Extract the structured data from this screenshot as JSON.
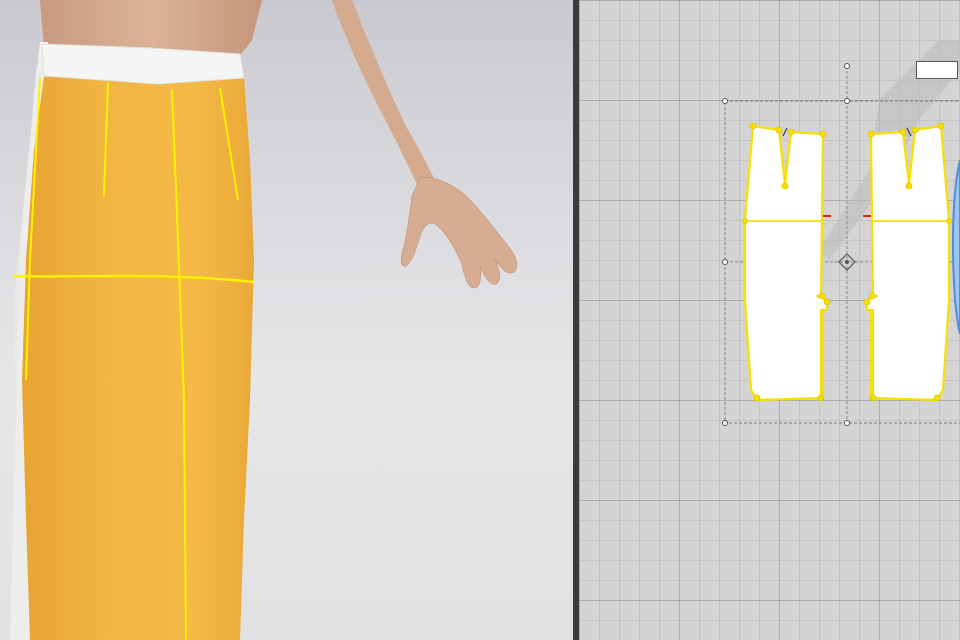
{
  "app": {
    "viewports": [
      "3d-avatar-view",
      "2d-pattern-view"
    ]
  },
  "colors": {
    "garment": "#f2b640",
    "seam_line": "#fff200",
    "waistband": "#f4f4f2",
    "pattern_fill": "#ffffff",
    "pattern_outline": "#f7e000",
    "grid_bg": "#d4d4d4",
    "bounding_box": "#777777",
    "notch_red": "#e02020",
    "adjacent_piece": "#5ea0e0"
  },
  "view_3d": {
    "garment": "skirt",
    "avatar_visible": true
  },
  "view_2d": {
    "pattern_pieces": [
      "back-left-panel",
      "back-right-panel"
    ],
    "selection_active": true,
    "label_box_text": ""
  }
}
